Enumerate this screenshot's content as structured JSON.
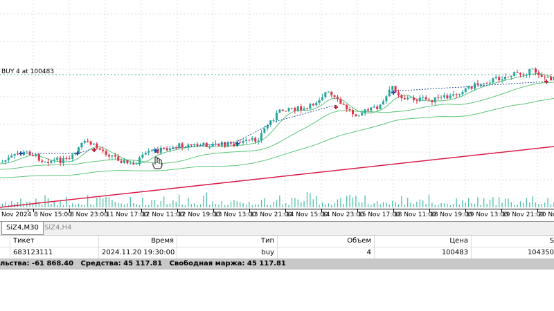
{
  "chart": {
    "order_line_label": "BUY 4 at 100483",
    "colors": {
      "bull": "#26a69a",
      "bear": "#e0344b",
      "ma": "#5cc47a",
      "long_ma": "#d81b46",
      "order_line": "#48b3a0",
      "volume": "#4cc0aa",
      "trade_line": "#2c4f9e"
    },
    "x_labels": [
      "Nov 2024",
      "8 Nov 15:00",
      "8 Nov 23:00",
      "11 Nov 17:00",
      "12 Nov 11:00",
      "12 Nov 19:00",
      "13 Nov 13:00",
      "13 Nov 21:00",
      "14 Nov 15:00",
      "14 Nov 23:00",
      "15 Nov 17:00",
      "18 Nov 11:00",
      "18 Nov 19:00",
      "19 Nov 13:00",
      "19 Nov 21:00",
      "20 Nov"
    ]
  },
  "tabs": [
    {
      "label": "SiZ4,M30",
      "active": true
    },
    {
      "label": "SiZ4,H4",
      "active": false
    }
  ],
  "table": {
    "headers": [
      "Тикет",
      "Время",
      "Тип",
      "Объем",
      "Цена",
      "S"
    ],
    "rows": [
      [
        "683123111",
        "2024.11.20 19:30:00",
        "buy",
        "4",
        "100483",
        "104350"
      ]
    ]
  },
  "status": {
    "text1": "льства: -61 868.40",
    "text2": "Средства: 45 117.81",
    "text3": "Свободная маржа: 45 117.81"
  }
}
